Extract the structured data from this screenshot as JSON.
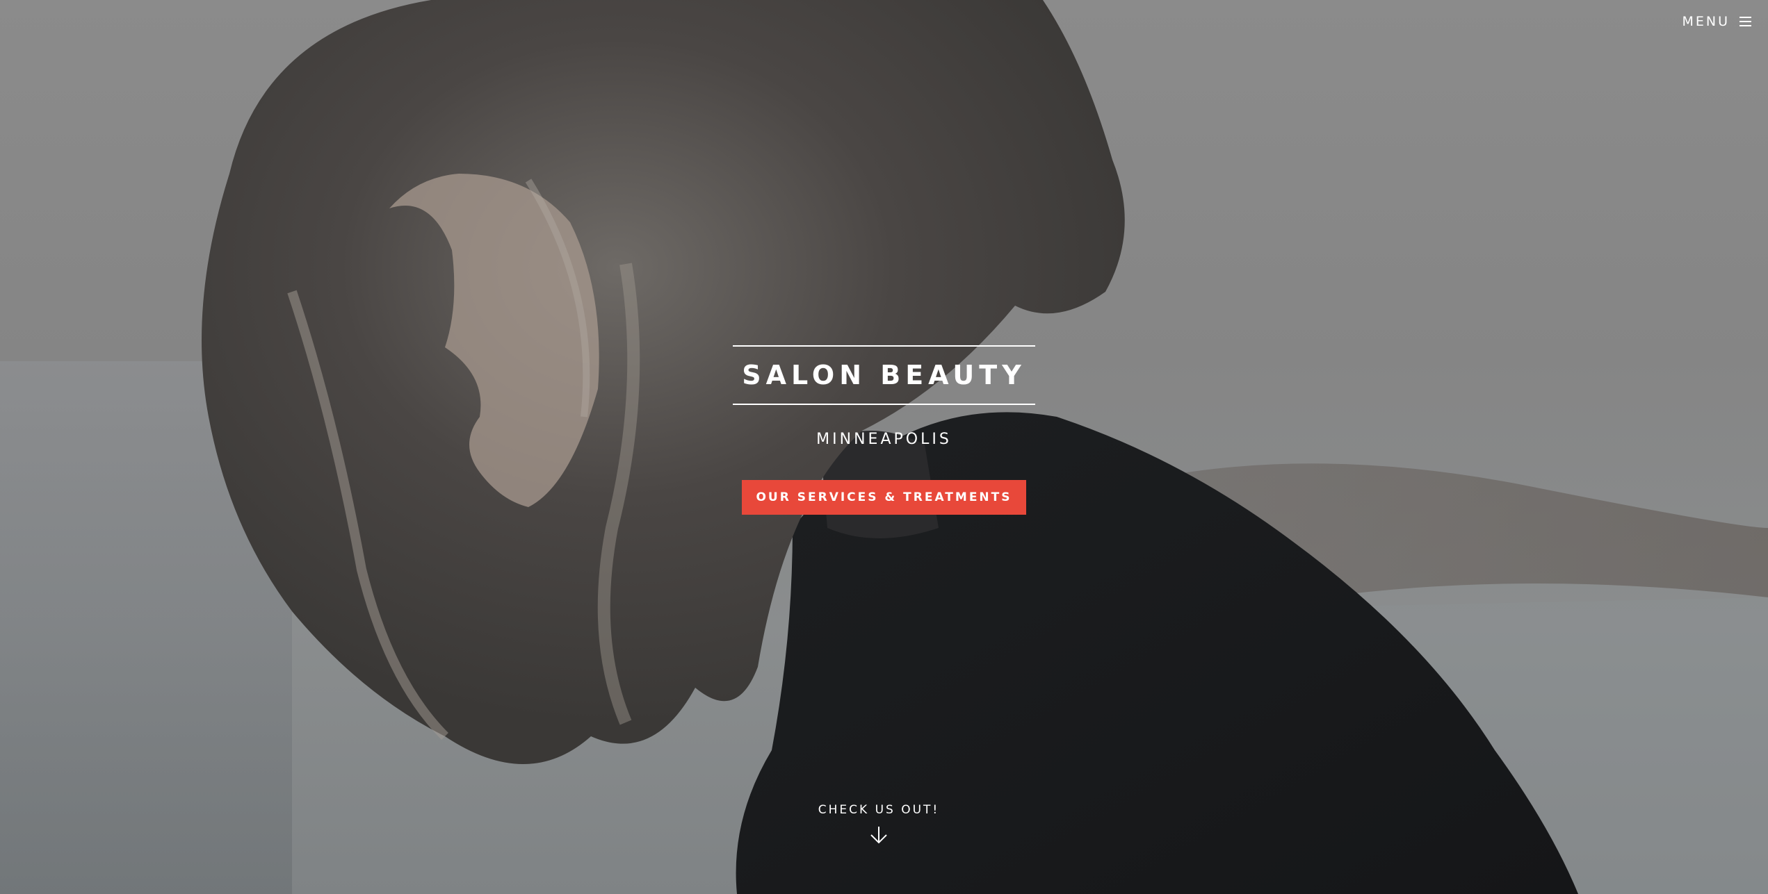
{
  "nav": {
    "menu_label": "MENU",
    "menu_icon": "hamburger-icon"
  },
  "hero": {
    "title": "SALON BEAUTY",
    "location": "MINNEAPOLIS",
    "cta_label": "OUR SERVICES & TREATMENTS",
    "scroll_label": "CHECK US OUT!",
    "scroll_icon": "arrow-down-icon"
  },
  "colors": {
    "accent": "#e8483a",
    "text": "#ffffff",
    "overlay": "#858585"
  }
}
